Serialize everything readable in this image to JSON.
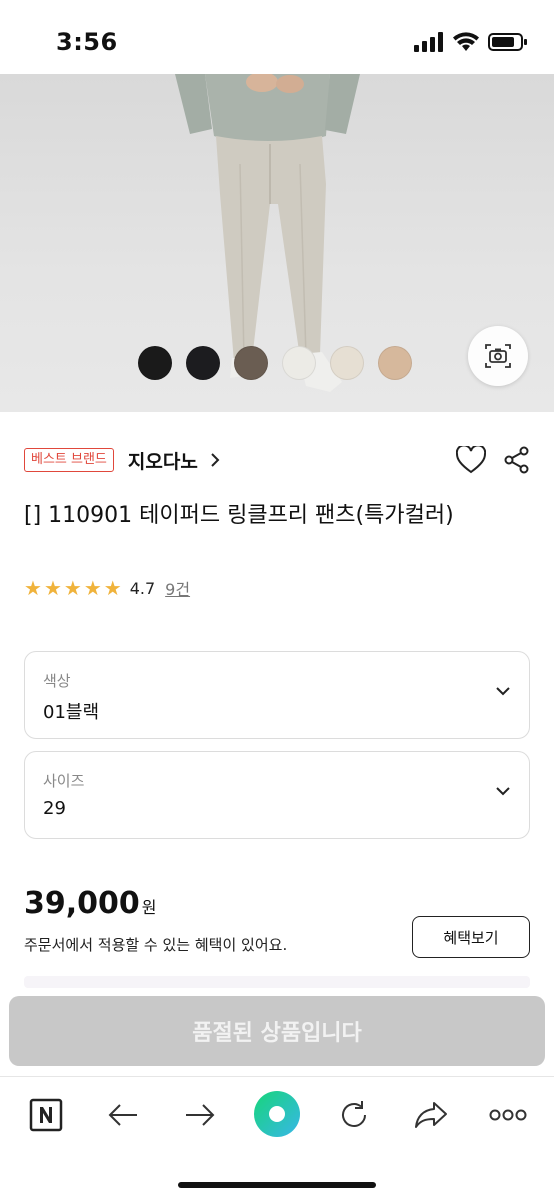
{
  "status_bar": {
    "time": "3:56"
  },
  "hero": {
    "swatch_colors": [
      "#1a1a1a",
      "#1c1c1f",
      "#6a5d52",
      "#ecebe6",
      "#e6dfd3",
      "#d6b89c"
    ],
    "lens_icon": "camera-search-icon"
  },
  "product": {
    "badge": "베스트 브랜드",
    "brand": "지오다노",
    "title": "[] 110901 테이퍼드 링클프리 팬츠(특가컬러)",
    "rating": {
      "stars": 5,
      "score": "4.7",
      "reviews": "9건"
    }
  },
  "options": {
    "color": {
      "label": "색상",
      "value": "01블랙"
    },
    "size": {
      "label": "사이즈",
      "value": "29"
    }
  },
  "price": {
    "amount": "39,000",
    "unit": "원",
    "benefit_text": "주문서에서 적용할 수 있는 혜택이 있어요.",
    "benefit_button": "혜택보기"
  },
  "cta": {
    "label": "품절된 상품입니다"
  },
  "browser": {
    "icons": [
      "naver-logo-icon",
      "back-arrow-icon",
      "forward-arrow-icon",
      "green-dot-icon",
      "refresh-icon",
      "share-forward-icon",
      "more-dots-icon"
    ]
  },
  "colors": {
    "accent_red": "#e0473b",
    "star": "#f0b33c",
    "naver_green": "#03c75a"
  }
}
